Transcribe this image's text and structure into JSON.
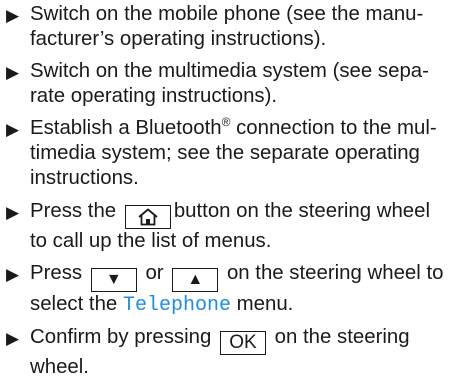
{
  "bullet_glyph": "▶",
  "accent_color": "#1a8fe0",
  "steps": [
    {
      "text": "Switch on the mobile phone (see the manu-facturer’s operating instructions)."
    },
    {
      "text": "Switch on the multimedia system (see sepa-rate operating instructions)."
    },
    {
      "text_before_mark": "Establish a Bluetooth",
      "mark": "®",
      "text_after_mark": " connection to the mul-timedia system; see the separate operating instructions."
    },
    {
      "text_before": "Press the",
      "key_icon": "home-icon",
      "text_after": "button on the steering wheel to call up the list of menus."
    },
    {
      "text_before": "Press",
      "key1": "▼",
      "text_mid": "or",
      "key2": "▲",
      "text_after": "on the steering wheel to select the",
      "highlight": "Telephone",
      "text_end": "menu."
    },
    {
      "text_before": "Confirm by pressing",
      "key": "OK",
      "text_after": "on the steering wheel."
    }
  ]
}
